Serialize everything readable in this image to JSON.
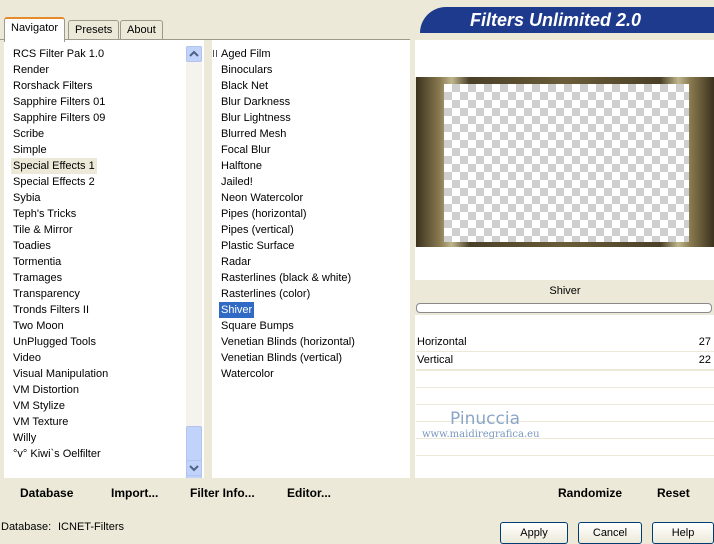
{
  "tabs": [
    {
      "label": "Navigator"
    },
    {
      "label": "Presets"
    },
    {
      "label": "About"
    }
  ],
  "title": "Filters Unlimited 2.0",
  "categories": [
    "RCS Filter Pak 1.0",
    "Render",
    "Rorshack Filters",
    "Sapphire Filters 01",
    "Sapphire Filters 09",
    "Scribe",
    "Simple",
    "Special Effects 1",
    "Special Effects 2",
    "Sybia",
    "Teph's Tricks",
    "Tile & Mirror",
    "Toadies",
    "Tormentia",
    "Tramages",
    "Transparency",
    "Tronds Filters II",
    "Two Moon",
    "UnPlugged Tools",
    "Video",
    "Visual Manipulation",
    "VM Distortion",
    "VM Stylize",
    "VM Texture",
    "Willy",
    "°v° Kiwi`s Oelfilter"
  ],
  "selected_category": "Special Effects 1",
  "filters": [
    "Aged Film",
    "Binoculars",
    "Black Net",
    "Blur Darkness",
    "Blur Lightness",
    "Blurred Mesh",
    "Focal Blur",
    "Halftone",
    "Jailed!",
    "Neon Watercolor",
    "Pipes (horizontal)",
    "Pipes (vertical)",
    "Plastic Surface",
    "Radar",
    "Rasterlines (black & white)",
    "Rasterlines (color)",
    "Shiver",
    "Square Bumps",
    "Venetian Blinds (horizontal)",
    "Venetian Blinds (vertical)",
    "Watercolor"
  ],
  "selected_filter": "Shiver",
  "filter_name": "Shiver",
  "params": [
    {
      "label": "Horizontal",
      "value": "27"
    },
    {
      "label": "Vertical",
      "value": "22"
    }
  ],
  "watermark": {
    "name": "Pinuccia",
    "url": "www.maidiregrafica.eu"
  },
  "buttons": {
    "database": "Database",
    "import": "Import...",
    "filter_info": "Filter Info...",
    "editor": "Editor...",
    "randomize": "Randomize",
    "reset": "Reset",
    "apply": "Apply",
    "cancel": "Cancel",
    "help": "Help"
  },
  "status": {
    "label": "Database:",
    "value": "ICNET-Filters"
  },
  "icons": {
    "scroll_up": "arrow-up-icon",
    "scroll_down": "arrow-down-icon"
  },
  "colors": {
    "selection": "#316ac5",
    "banner": "#1d3a8c",
    "tab_accent": "#e68b2c"
  }
}
